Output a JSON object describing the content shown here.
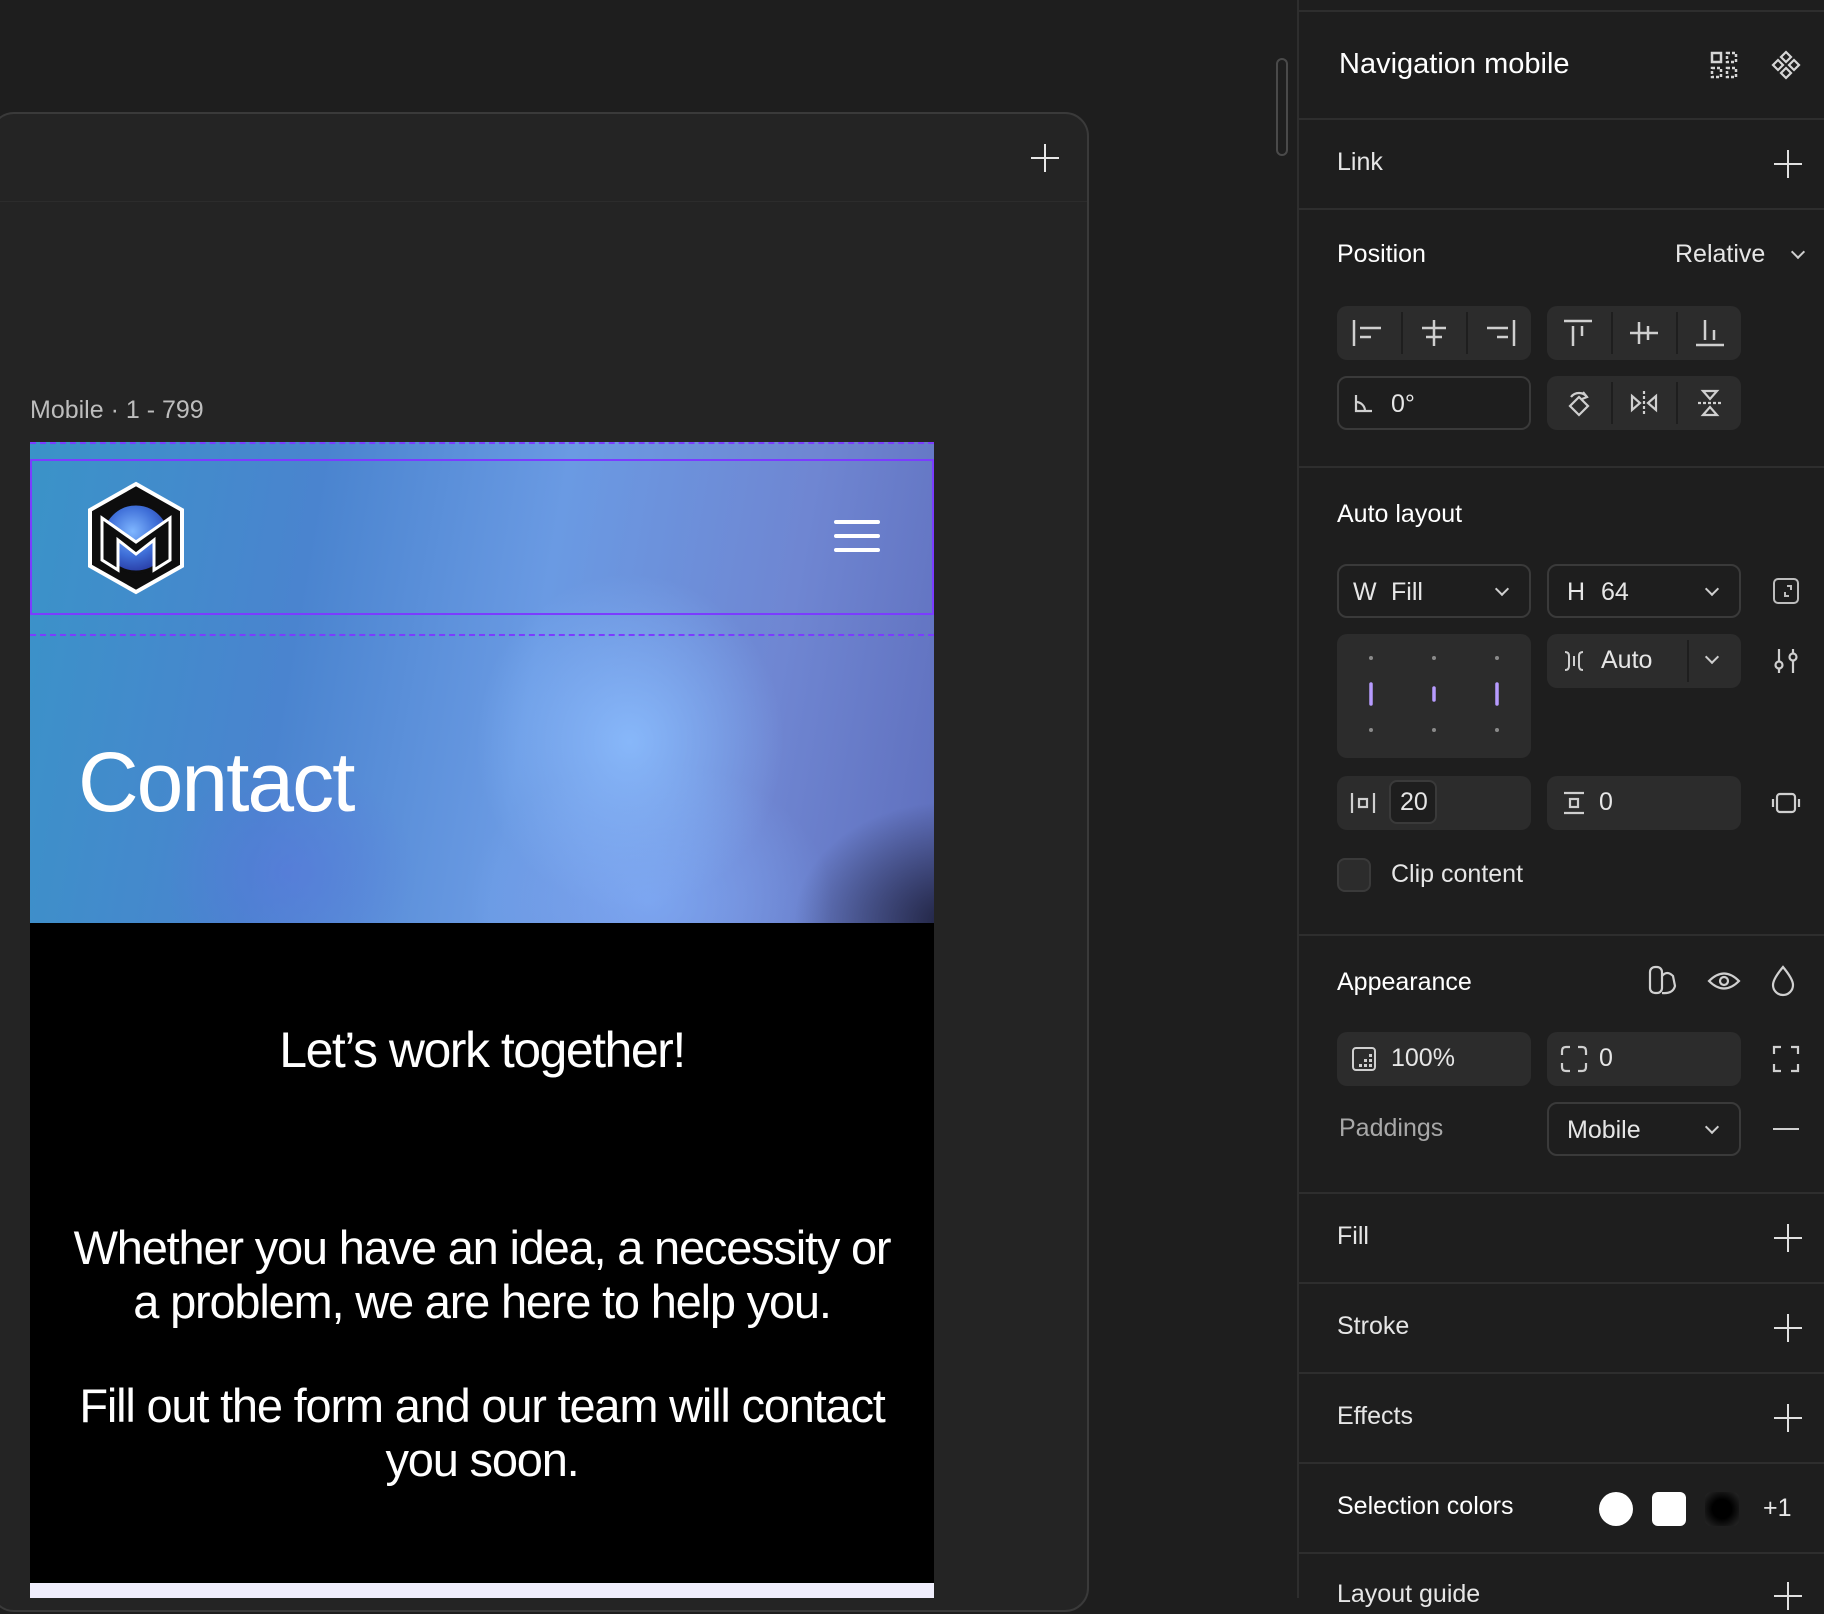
{
  "canvas": {
    "frame_label": "Mobile · 1 - 799"
  },
  "mobile": {
    "hero_title": "Contact",
    "subheading": "Let’s work together!",
    "paragraph1": "Whether you have an idea, a necessity or a problem, we are here to help you.",
    "paragraph2": "Fill out the form and our team will contact you soon."
  },
  "panel": {
    "title": "Navigation mobile",
    "link": {
      "label": "Link"
    },
    "position": {
      "label": "Position",
      "value": "Relative",
      "rotation": "0°"
    },
    "auto_layout": {
      "label": "Auto layout",
      "width_prefix": "W",
      "width_value": "Fill",
      "height_prefix": "H",
      "height_value": "64",
      "gap_value": "Auto",
      "padding_h": "20",
      "padding_v": "0",
      "clip_label": "Clip content"
    },
    "appearance": {
      "label": "Appearance",
      "opacity": "100%",
      "radius": "0",
      "paddings_label": "Paddings",
      "paddings_value": "Mobile"
    },
    "fill": {
      "label": "Fill"
    },
    "stroke": {
      "label": "Stroke"
    },
    "effects": {
      "label": "Effects"
    },
    "selection_colors": {
      "label": "Selection colors",
      "more": "+1",
      "colors": [
        "#ffffff",
        "#ffffff",
        "#000000"
      ]
    },
    "layout_guide": {
      "label": "Layout guide"
    }
  }
}
